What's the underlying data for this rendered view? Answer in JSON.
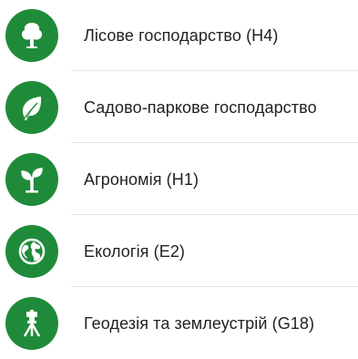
{
  "colors": {
    "icon_background": "#1f8b3a",
    "icon_foreground": "#ffffff",
    "text": "#222222",
    "divider": "#e6e6e6"
  },
  "items": [
    {
      "label": "Лісове господарство (Н4)",
      "icon": "tree-icon"
    },
    {
      "label": "Садово-паркове господарство",
      "icon": "leaf-icon"
    },
    {
      "label": "Агрономія (Н1)",
      "icon": "sprout-icon"
    },
    {
      "label": "Екологія (Е2)",
      "icon": "globe-icon"
    },
    {
      "label": "Геодезія та землеустрій (G18)",
      "icon": "theodolite-icon"
    }
  ]
}
